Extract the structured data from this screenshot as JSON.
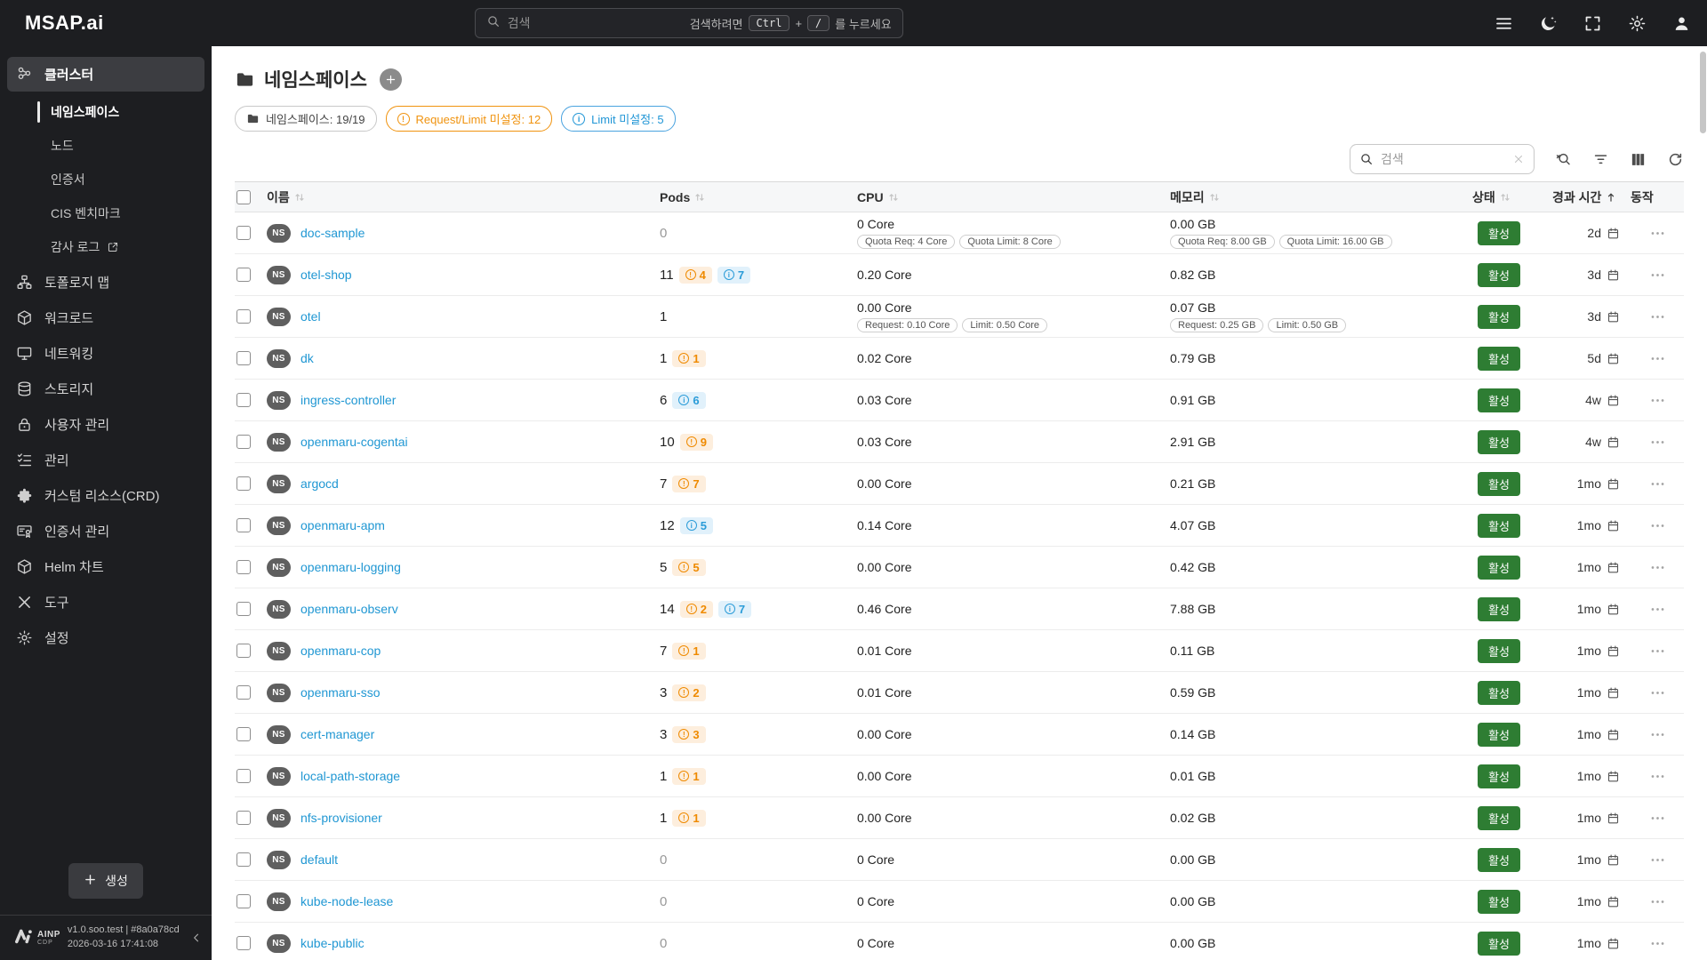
{
  "colors": {
    "brand_red": "#e8212e",
    "header_bg": "#1d1e21",
    "link_blue": "#2097d3",
    "status_green": "#2e7d33",
    "warning_orange": "#f0930f",
    "info_blue": "#2b9cd8"
  },
  "brand": {
    "logo_text": "MSAP.ai"
  },
  "header": {
    "search": {
      "placeholder": "검색",
      "hint_prefix": "검색하려면",
      "key_ctrl": "Ctrl",
      "joiner": "+",
      "key_slash": "/",
      "hint_suffix": "를 누르세요"
    }
  },
  "sidebar": {
    "items": [
      {
        "id": "cluster",
        "label": "클러스터",
        "icon": "cluster",
        "active": true,
        "children": [
          {
            "id": "namespace",
            "label": "네임스페이스",
            "active": true
          },
          {
            "id": "node",
            "label": "노드"
          },
          {
            "id": "certificate",
            "label": "인증서"
          },
          {
            "id": "cis-benchmark",
            "label": "CIS 벤치마크"
          },
          {
            "id": "audit-log",
            "label": "감사 로그",
            "external": true
          }
        ]
      },
      {
        "id": "topology-map",
        "label": "토폴로지 맵",
        "icon": "topology"
      },
      {
        "id": "workload",
        "label": "워크로드",
        "icon": "workload"
      },
      {
        "id": "networking",
        "label": "네트워킹",
        "icon": "network"
      },
      {
        "id": "storage",
        "label": "스토리지",
        "icon": "storage"
      },
      {
        "id": "user-management",
        "label": "사용자 관리",
        "icon": "lock"
      },
      {
        "id": "management",
        "label": "관리",
        "icon": "tasks"
      },
      {
        "id": "custom-resource-crd",
        "label": "커스텀 리소스(CRD)",
        "icon": "puzzle"
      },
      {
        "id": "certificate-management",
        "label": "인증서 관리",
        "icon": "certificate"
      },
      {
        "id": "helm-chart",
        "label": "Helm 차트",
        "icon": "helm"
      },
      {
        "id": "tools",
        "label": "도구",
        "icon": "tools"
      },
      {
        "id": "settings",
        "label": "설정",
        "icon": "gear"
      }
    ],
    "create_label": "생성",
    "footer": {
      "logo_main": "AINP",
      "logo_sub": "CDP",
      "version": "v1.0.soo.test | #8a0a78cd",
      "timestamp": "2026-03-16 17:41:08"
    }
  },
  "page": {
    "title": "네임스페이스",
    "summary_pills": [
      {
        "type": "neutral",
        "icon": "folder",
        "label": "네임스페이스: 19/19"
      },
      {
        "type": "warning",
        "icon": "alert",
        "label": "Request/Limit 미설정: 12"
      },
      {
        "type": "info",
        "icon": "info",
        "label": "Limit 미설정: 5"
      }
    ],
    "toolbar": {
      "search_placeholder": "검색"
    }
  },
  "table": {
    "columns": [
      {
        "key": "name",
        "label": "이름",
        "sortable": true
      },
      {
        "key": "pods",
        "label": "Pods",
        "sortable": true
      },
      {
        "key": "cpu",
        "label": "CPU",
        "sortable": true
      },
      {
        "key": "memory",
        "label": "메모리",
        "sortable": true
      },
      {
        "key": "status",
        "label": "상태",
        "sortable": true
      },
      {
        "key": "age",
        "label": "경과 시간",
        "sortable": true,
        "sorted": "asc"
      },
      {
        "key": "actions",
        "label": "동작",
        "sortable": false
      }
    ],
    "rows": [
      {
        "name": "doc-sample",
        "pods": "0",
        "pod_badges": [],
        "cpu": "0 Core",
        "cpu_tags": [
          "Quota Req: 4 Core",
          "Quota Limit: 8 Core"
        ],
        "memory": "0.00 GB",
        "memory_tags": [
          "Quota Req: 8.00 GB",
          "Quota Limit: 16.00 GB"
        ],
        "status": "활성",
        "age": "2d"
      },
      {
        "name": "otel-shop",
        "pods": "11",
        "pod_badges": [
          {
            "type": "warning",
            "count": "4"
          },
          {
            "type": "info",
            "count": "7"
          }
        ],
        "cpu": "0.20 Core",
        "cpu_tags": [],
        "memory": "0.82 GB",
        "memory_tags": [],
        "status": "활성",
        "age": "3d"
      },
      {
        "name": "otel",
        "pods": "1",
        "pod_badges": [],
        "cpu": "0.00 Core",
        "cpu_tags": [
          "Request: 0.10 Core",
          "Limit: 0.50 Core"
        ],
        "memory": "0.07 GB",
        "memory_tags": [
          "Request: 0.25 GB",
          "Limit: 0.50 GB"
        ],
        "status": "활성",
        "age": "3d"
      },
      {
        "name": "dk",
        "pods": "1",
        "pod_badges": [
          {
            "type": "warning",
            "count": "1"
          }
        ],
        "cpu": "0.02 Core",
        "cpu_tags": [],
        "memory": "0.79 GB",
        "memory_tags": [],
        "status": "활성",
        "age": "5d"
      },
      {
        "name": "ingress-controller",
        "pods": "6",
        "pod_badges": [
          {
            "type": "info",
            "count": "6"
          }
        ],
        "cpu": "0.03 Core",
        "cpu_tags": [],
        "memory": "0.91 GB",
        "memory_tags": [],
        "status": "활성",
        "age": "4w"
      },
      {
        "name": "openmaru-cogentai",
        "pods": "10",
        "pod_badges": [
          {
            "type": "warning",
            "count": "9"
          }
        ],
        "cpu": "0.03 Core",
        "cpu_tags": [],
        "memory": "2.91 GB",
        "memory_tags": [],
        "status": "활성",
        "age": "4w"
      },
      {
        "name": "argocd",
        "pods": "7",
        "pod_badges": [
          {
            "type": "warning",
            "count": "7"
          }
        ],
        "cpu": "0.00 Core",
        "cpu_tags": [],
        "memory": "0.21 GB",
        "memory_tags": [],
        "status": "활성",
        "age": "1mo"
      },
      {
        "name": "openmaru-apm",
        "pods": "12",
        "pod_badges": [
          {
            "type": "info",
            "count": "5"
          }
        ],
        "cpu": "0.14 Core",
        "cpu_tags": [],
        "memory": "4.07 GB",
        "memory_tags": [],
        "status": "활성",
        "age": "1mo"
      },
      {
        "name": "openmaru-logging",
        "pods": "5",
        "pod_badges": [
          {
            "type": "warning",
            "count": "5"
          }
        ],
        "cpu": "0.00 Core",
        "cpu_tags": [],
        "memory": "0.42 GB",
        "memory_tags": [],
        "status": "활성",
        "age": "1mo"
      },
      {
        "name": "openmaru-observ",
        "pods": "14",
        "pod_badges": [
          {
            "type": "warning",
            "count": "2"
          },
          {
            "type": "info",
            "count": "7"
          }
        ],
        "cpu": "0.46 Core",
        "cpu_tags": [],
        "memory": "7.88 GB",
        "memory_tags": [],
        "status": "활성",
        "age": "1mo"
      },
      {
        "name": "openmaru-cop",
        "pods": "7",
        "pod_badges": [
          {
            "type": "warning",
            "count": "1"
          }
        ],
        "cpu": "0.01 Core",
        "cpu_tags": [],
        "memory": "0.11 GB",
        "memory_tags": [],
        "status": "활성",
        "age": "1mo"
      },
      {
        "name": "openmaru-sso",
        "pods": "3",
        "pod_badges": [
          {
            "type": "warning",
            "count": "2"
          }
        ],
        "cpu": "0.01 Core",
        "cpu_tags": [],
        "memory": "0.59 GB",
        "memory_tags": [],
        "status": "활성",
        "age": "1mo"
      },
      {
        "name": "cert-manager",
        "pods": "3",
        "pod_badges": [
          {
            "type": "warning",
            "count": "3"
          }
        ],
        "cpu": "0.00 Core",
        "cpu_tags": [],
        "memory": "0.14 GB",
        "memory_tags": [],
        "status": "활성",
        "age": "1mo"
      },
      {
        "name": "local-path-storage",
        "pods": "1",
        "pod_badges": [
          {
            "type": "warning",
            "count": "1"
          }
        ],
        "cpu": "0.00 Core",
        "cpu_tags": [],
        "memory": "0.01 GB",
        "memory_tags": [],
        "status": "활성",
        "age": "1mo"
      },
      {
        "name": "nfs-provisioner",
        "pods": "1",
        "pod_badges": [
          {
            "type": "warning",
            "count": "1"
          }
        ],
        "cpu": "0.00 Core",
        "cpu_tags": [],
        "memory": "0.02 GB",
        "memory_tags": [],
        "status": "활성",
        "age": "1mo"
      },
      {
        "name": "default",
        "pods": "0",
        "pod_badges": [],
        "cpu": "0 Core",
        "cpu_tags": [],
        "memory": "0.00 GB",
        "memory_tags": [],
        "status": "활성",
        "age": "1mo"
      },
      {
        "name": "kube-node-lease",
        "pods": "0",
        "pod_badges": [],
        "cpu": "0 Core",
        "cpu_tags": [],
        "memory": "0.00 GB",
        "memory_tags": [],
        "status": "활성",
        "age": "1mo"
      },
      {
        "name": "kube-public",
        "pods": "0",
        "pod_badges": [],
        "cpu": "0 Core",
        "cpu_tags": [],
        "memory": "0.00 GB",
        "memory_tags": [],
        "status": "활성",
        "age": "1mo"
      }
    ]
  }
}
